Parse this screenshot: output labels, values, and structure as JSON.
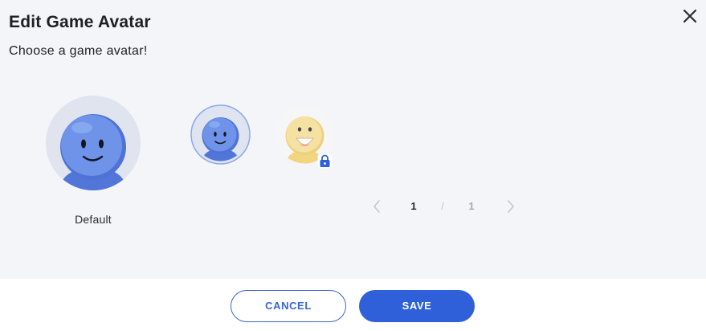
{
  "dialog": {
    "title": "Edit Game Avatar",
    "subtitle": "Choose a game avatar!"
  },
  "current_avatar": {
    "label": "Default",
    "icon": "blue-smiley-avatar"
  },
  "avatar_options": [
    {
      "icon": "blue-smiley-avatar",
      "selected": true,
      "locked": false
    },
    {
      "icon": "yellow-laughing-avatar",
      "selected": false,
      "locked": true
    }
  ],
  "pagination": {
    "current": "1",
    "separator": "/",
    "total": "1"
  },
  "footer": {
    "cancel_label": "CANCEL",
    "save_label": "SAVE"
  },
  "colors": {
    "accent": "#2f5fd9",
    "panel_bg": "#f4f5f9",
    "avatar_blue": "#6b8fe6",
    "avatar_yellow": "#f3d77f"
  }
}
